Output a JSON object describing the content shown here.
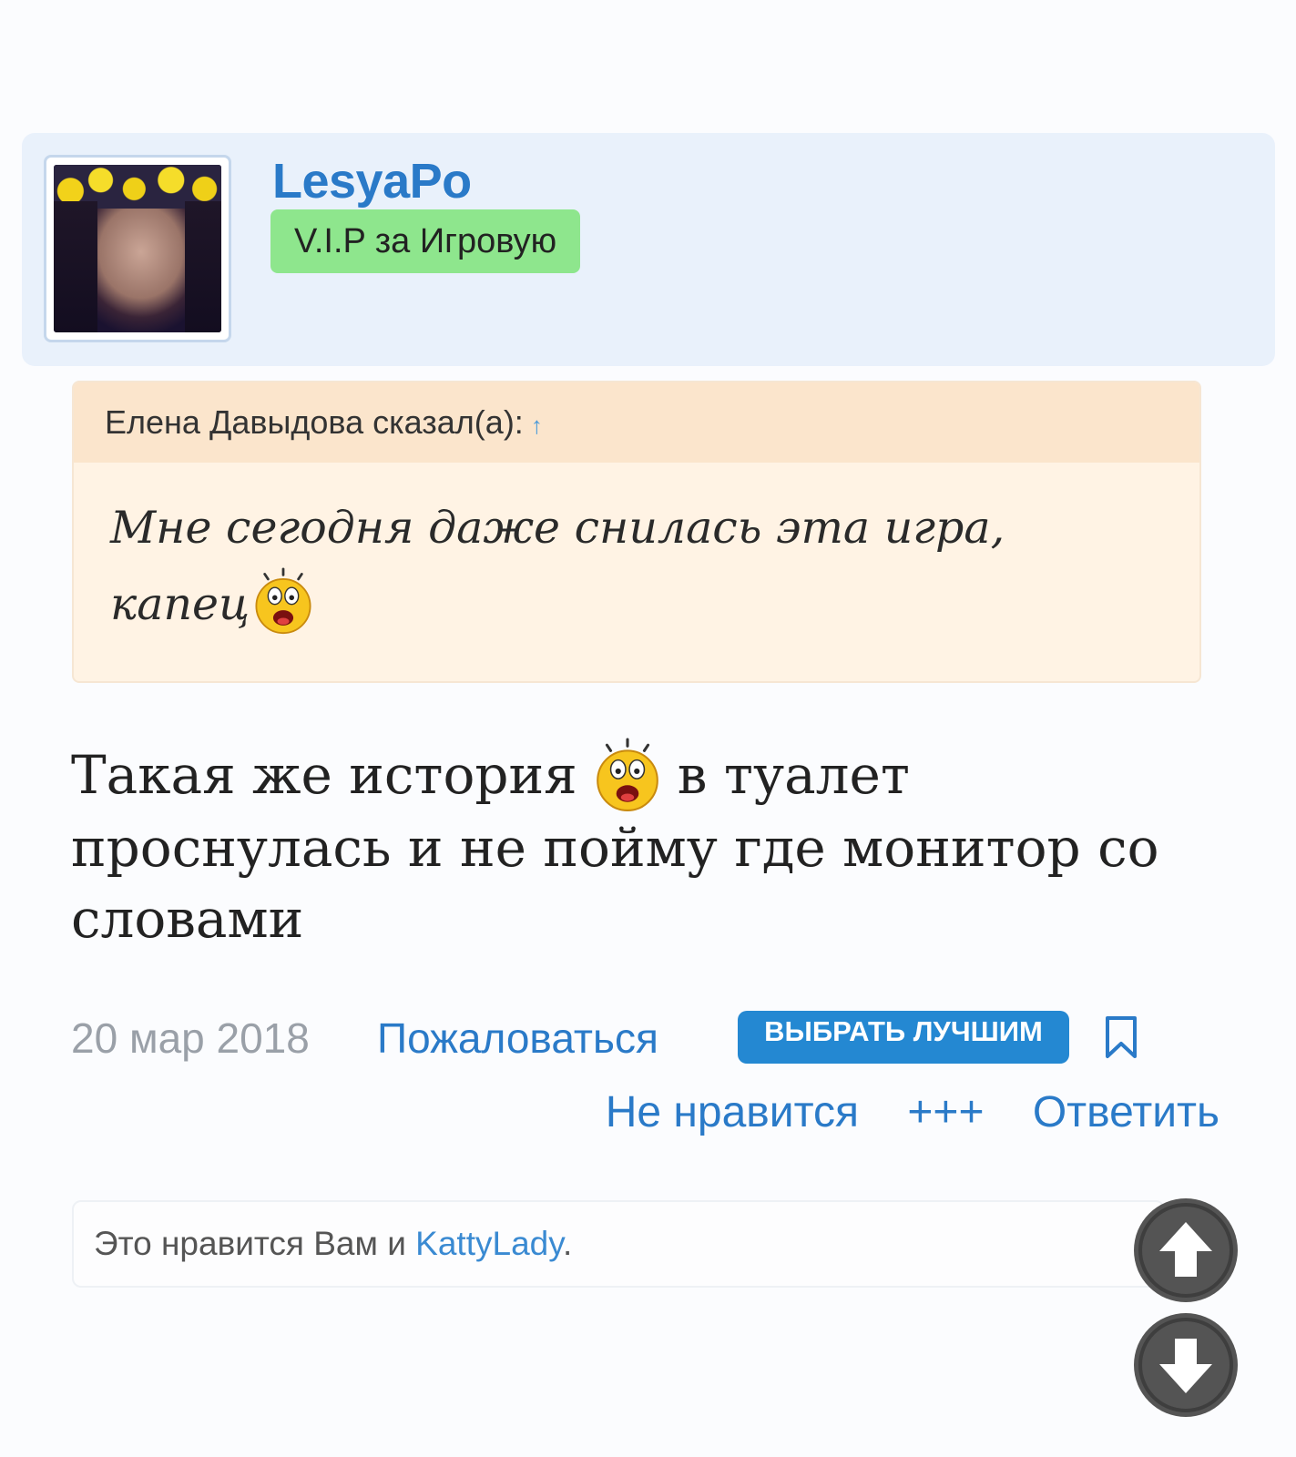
{
  "author": {
    "username": "LesyaPo",
    "role": "V.I.P за Игровую"
  },
  "quote": {
    "header": "Елена Давыдова сказал(а):",
    "arrow": "↑",
    "line1": "Мне сегодня даже снилась эта игра,",
    "line2": "капец"
  },
  "post": {
    "text_part1": "Такая же история",
    "text_part2": "в туалет проснулась и не пойму где монитор со словами"
  },
  "meta": {
    "date": "20 мар 2018",
    "report_label": "Пожаловаться",
    "best_label": "ВЫБРАТЬ ЛУЧШИМ"
  },
  "actions": {
    "dislike_label": "Не нравится",
    "plus_label": "+++",
    "reply_label": "Ответить"
  },
  "likes": {
    "prefix": "Это нравится Вам и",
    "user": "KattyLady",
    "suffix": "."
  },
  "colors": {
    "accent": "#2a7ac8",
    "badge": "#8ee68d",
    "quote_bg": "#fff3e4",
    "best_button": "#2488d2"
  },
  "icons": [
    "shocked-emoji-icon",
    "bookmark-icon",
    "scroll-up-icon",
    "scroll-down-icon"
  ]
}
